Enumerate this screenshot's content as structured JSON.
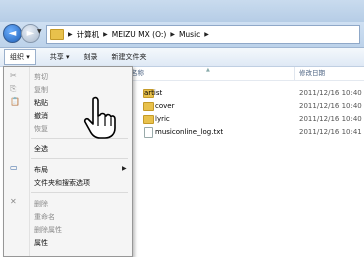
{
  "address": {
    "breadcrumbs": [
      "计算机",
      "MEIZU MX (O:)",
      "Music"
    ]
  },
  "toolbar": {
    "organize": "组织 ▾",
    "share": "共享 ▾",
    "burn": "刻录",
    "new_folder": "新建文件夹"
  },
  "columns": {
    "name": "名称",
    "date": "修改日期"
  },
  "files": [
    {
      "name": "artist",
      "date": "2011/12/16 10:40",
      "type": "folder"
    },
    {
      "name": "cover",
      "date": "2011/12/16 10:40",
      "type": "folder"
    },
    {
      "name": "lyric",
      "date": "2011/12/16 10:40",
      "type": "folder"
    },
    {
      "name": "musiconline_log.txt",
      "date": "2011/12/16 10:41",
      "type": "file"
    }
  ],
  "menu": {
    "cut": "剪切",
    "copy": "复制",
    "paste": "粘贴",
    "undo": "撤消",
    "redo": "恢复",
    "select_all": "全选",
    "layout": "布局",
    "folder_options": "文件夹和搜索选项",
    "delete": "删除",
    "rename": "重命名",
    "remove_properties": "删除属性",
    "properties": "属性"
  },
  "icons": {
    "back": "back-arrow-icon",
    "forward": "forward-arrow-icon",
    "cursor": "hand-pointer-icon"
  }
}
